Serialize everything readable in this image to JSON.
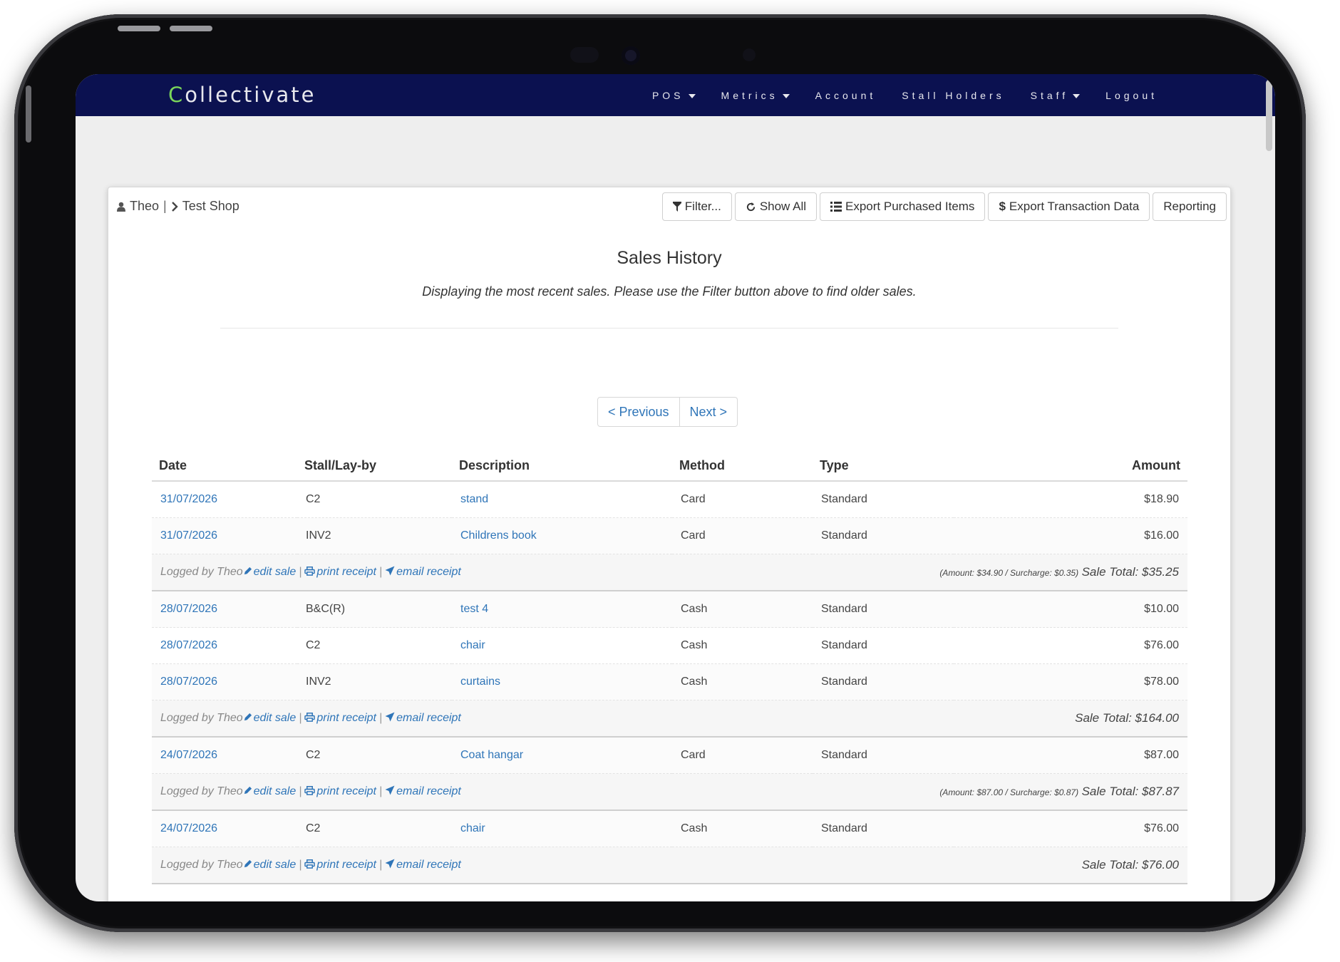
{
  "app": {
    "brand_first": "C",
    "brand_rest": "ollectivate",
    "nav": [
      {
        "label": "POS",
        "dropdown": true
      },
      {
        "label": "Metrics",
        "dropdown": true
      },
      {
        "label": "Account",
        "dropdown": false
      },
      {
        "label": "Stall Holders",
        "dropdown": false
      },
      {
        "label": "Staff",
        "dropdown": true
      },
      {
        "label": "Logout",
        "dropdown": false
      }
    ]
  },
  "breadcrumb": {
    "user": "Theo",
    "separator": "|",
    "shop": "Test Shop"
  },
  "toolbar": {
    "filter": "Filter...",
    "show_all": "Show All",
    "export_items": "Export Purchased Items",
    "export_transactions": "Export Transaction Data",
    "reporting": "Reporting",
    "export_transactions_icon": "$"
  },
  "page": {
    "title": "Sales History",
    "subtitle": "Displaying the most recent sales. Please use the Filter button above to find older sales."
  },
  "pager": {
    "previous": "< Previous",
    "next": "Next >"
  },
  "table": {
    "headers": [
      "Date",
      "Stall/Lay-by",
      "Description",
      "Method",
      "Type",
      "Amount"
    ],
    "sales": [
      {
        "items": [
          {
            "date": "31/07/2026",
            "stall": "C2",
            "description": "stand",
            "method": "Card",
            "type": "Standard",
            "amount": "$18.90"
          },
          {
            "date": "31/07/2026",
            "stall": "INV2",
            "description": "Childrens book",
            "method": "Card",
            "type": "Standard",
            "amount": "$16.00"
          }
        ],
        "logged_by": "Logged by Theo",
        "surcharge_note": "(Amount: $34.90 / Surcharge: $0.35)",
        "total": "Sale Total: $35.25"
      },
      {
        "items": [
          {
            "date": "28/07/2026",
            "stall": "B&C(R)",
            "description": "test 4",
            "method": "Cash",
            "type": "Standard",
            "amount": "$10.00"
          },
          {
            "date": "28/07/2026",
            "stall": "C2",
            "description": "chair",
            "method": "Cash",
            "type": "Standard",
            "amount": "$76.00"
          },
          {
            "date": "28/07/2026",
            "stall": "INV2",
            "description": "curtains",
            "method": "Cash",
            "type": "Standard",
            "amount": "$78.00"
          }
        ],
        "logged_by": "Logged by Theo",
        "surcharge_note": "",
        "total": "Sale Total: $164.00"
      },
      {
        "items": [
          {
            "date": "24/07/2026",
            "stall": "C2",
            "description": "Coat hangar",
            "method": "Card",
            "type": "Standard",
            "amount": "$87.00"
          }
        ],
        "logged_by": "Logged by Theo",
        "surcharge_note": "(Amount: $87.00 / Surcharge: $0.87)",
        "total": "Sale Total: $87.87"
      },
      {
        "items": [
          {
            "date": "24/07/2026",
            "stall": "C2",
            "description": "chair",
            "method": "Cash",
            "type": "Standard",
            "amount": "$76.00"
          }
        ],
        "logged_by": "Logged by Theo",
        "surcharge_note": "",
        "total": "Sale Total: $76.00"
      }
    ],
    "actions": {
      "edit": "edit sale",
      "print": "print receipt",
      "email": "email receipt",
      "separator": "|"
    }
  },
  "colors": {
    "navbar": "#0b1150",
    "link": "#2f75b8",
    "brand_accent": "#7bd65a"
  }
}
